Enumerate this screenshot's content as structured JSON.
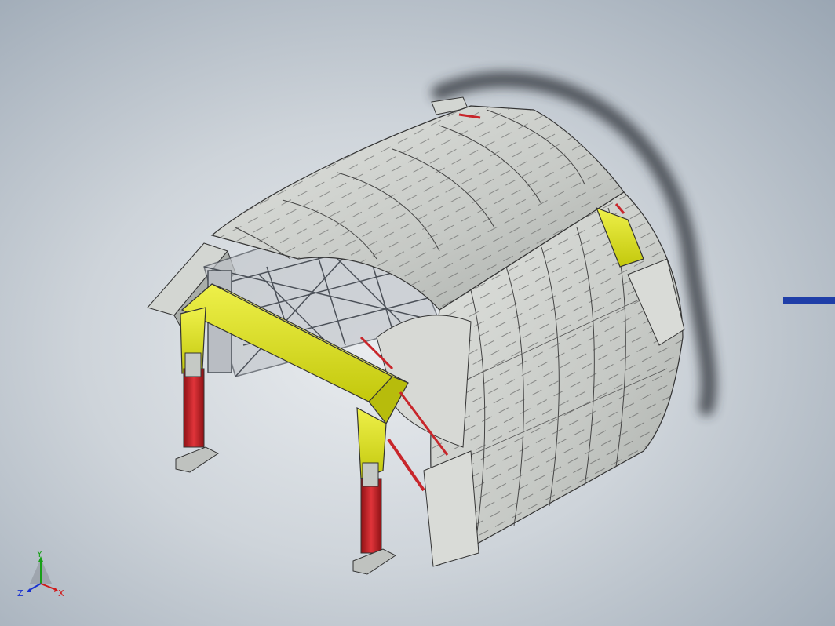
{
  "viewport": {
    "background_center": "#e9ecef",
    "background_edge": "#9aa6b3"
  },
  "model": {
    "description_icon": "tunnel-formwork-trolley-icon",
    "colors": {
      "portal_frame": "#d8df12",
      "portal_frame_dark": "#a9b00a",
      "hydraulic_cylinder": "#c8262b",
      "shell_panel": "#c9ccc8",
      "shell_panel_dark": "#9ea29e",
      "steel_truss": "#b8bcc2"
    }
  },
  "triad": {
    "x_label": "X",
    "y_label": "Y",
    "z_label": "Z",
    "x_color": "#d01818",
    "y_color": "#18a018",
    "z_color": "#1830d0"
  },
  "side_marker": {
    "color": "#1f3ea8"
  }
}
